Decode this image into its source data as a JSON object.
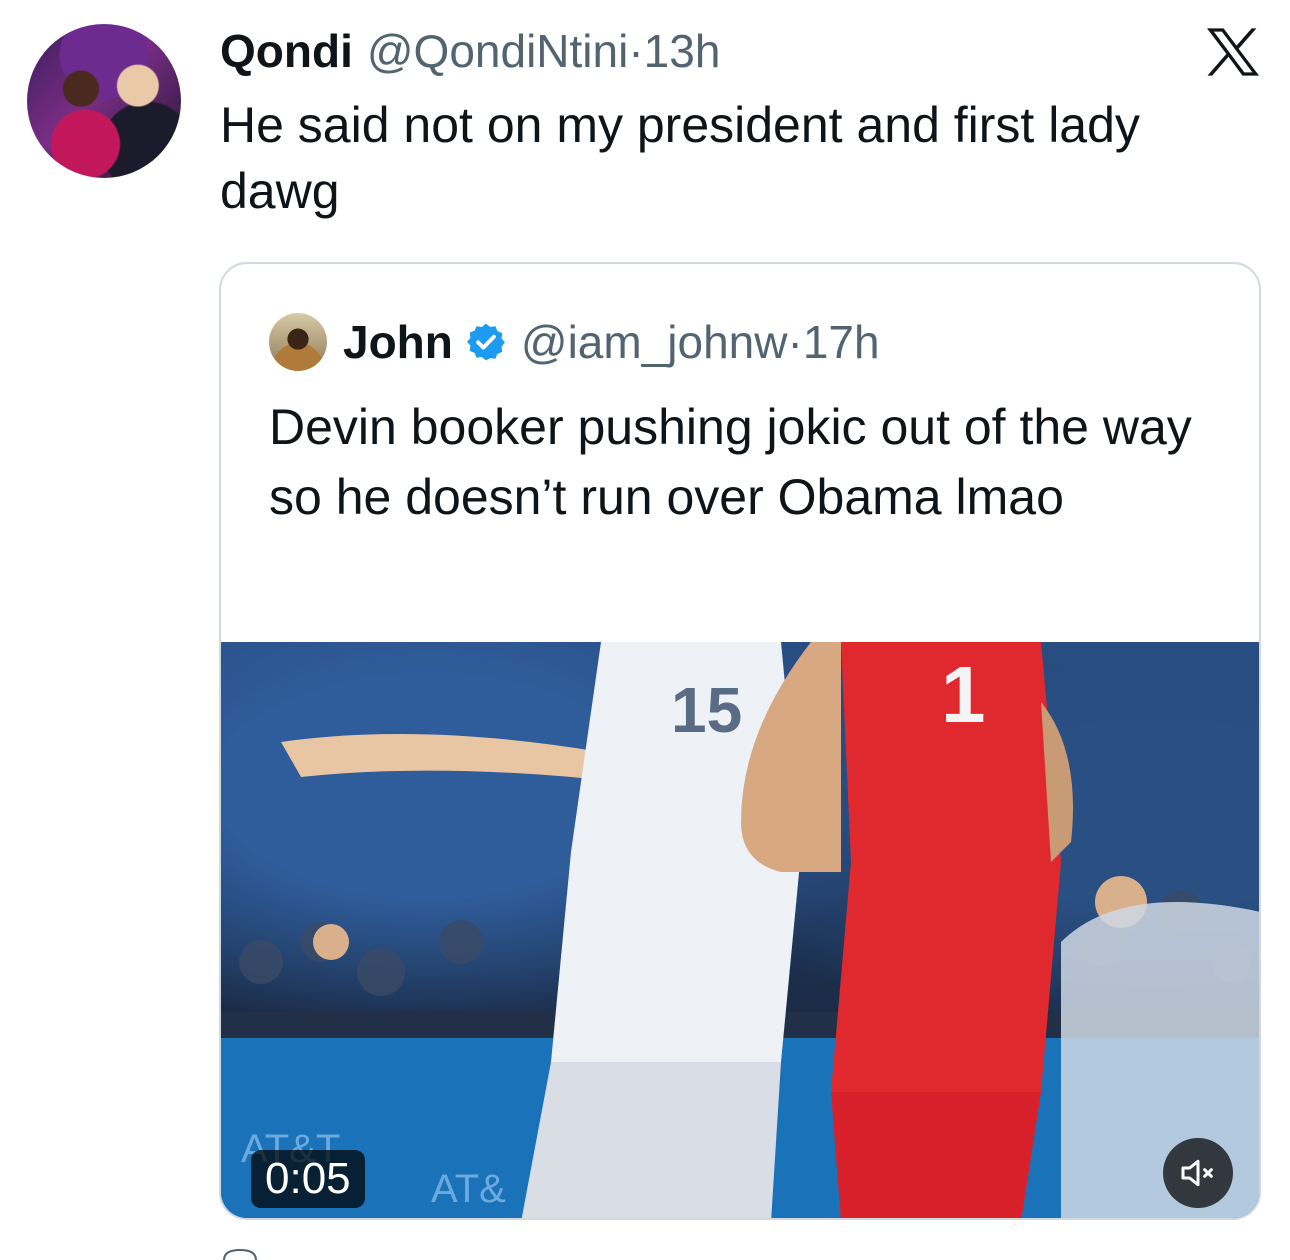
{
  "tweet": {
    "author_name": "Qondi",
    "author_handle": "@QondiNtini",
    "separator": "·",
    "time": "13h",
    "text": "He said not on my president and first lady dawg",
    "platform_icon": "x-logo-icon"
  },
  "quoted_tweet": {
    "author_name": "John",
    "verified": true,
    "author_handle": "@iam_johnw",
    "separator": "·",
    "time": "17h",
    "text": "Devin booker pushing jokic out of the way so he doesn’t run over Obama lmao",
    "media": {
      "type": "video",
      "duration": "0:05",
      "muted": true,
      "mute_icon": "speaker-muted-icon"
    }
  },
  "colors": {
    "text_primary": "#0f1419",
    "text_secondary": "#536471",
    "verified_blue": "#1d9bf0",
    "card_border": "#cfd9de"
  }
}
